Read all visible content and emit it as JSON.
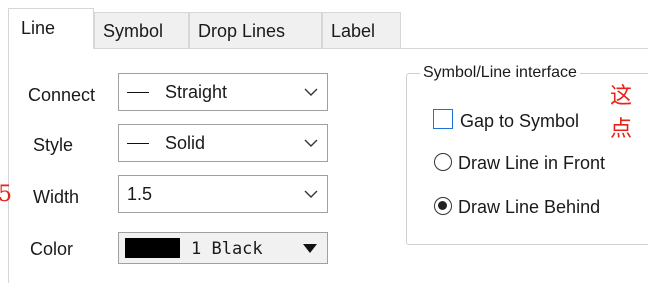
{
  "tabs": [
    {
      "label": "Line",
      "active": true
    },
    {
      "label": "Symbol"
    },
    {
      "label": "Drop Lines"
    },
    {
      "label": "Label"
    }
  ],
  "form": {
    "connect": {
      "label": "Connect",
      "value": "Straight"
    },
    "style": {
      "label": "Style",
      "value": "Solid"
    },
    "width": {
      "label": "Width",
      "value": "1.5"
    },
    "color": {
      "label": "Color",
      "value": "1 Black",
      "swatch": "#000000"
    }
  },
  "group": {
    "title": "Symbol/Line interface",
    "gap_to_symbol": {
      "label": "Gap to Symbol",
      "checked": false
    },
    "draw_front": {
      "label": "Draw Line in Front",
      "selected": false
    },
    "draw_behind": {
      "label": "Draw Line Behind",
      "selected": true
    }
  },
  "annotations": {
    "left_fragment": "5",
    "right_line1": "这",
    "right_line2": "点"
  },
  "colors": {
    "annotation": "#e8231a",
    "checkbox_border": "#1b73d6",
    "tab_inactive_bg": "#f0f0f0"
  }
}
